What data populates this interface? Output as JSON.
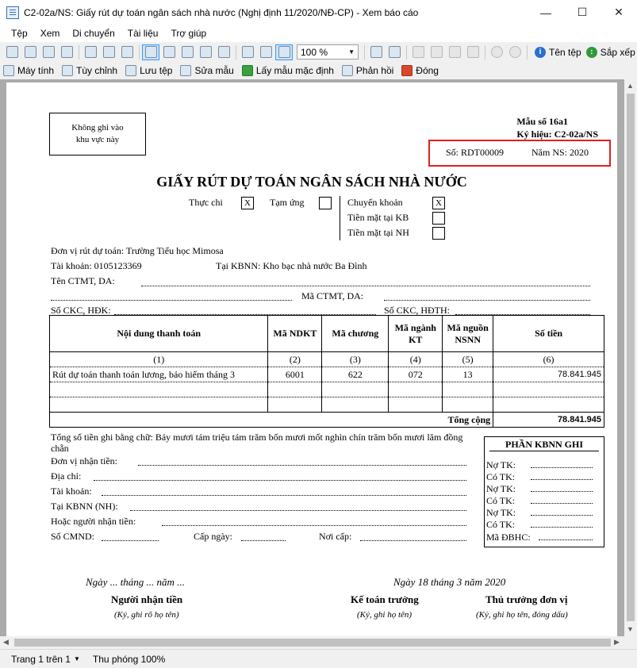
{
  "window": {
    "title": "C2-02a/NS: Giấy rút dự toán ngân sách nhà nước (Nghị định 11/2020/NĐ-CP) - Xem báo cáo",
    "minimize": "—",
    "maximize": "☐",
    "close": "✕"
  },
  "menu": [
    "Tệp",
    "Xem",
    "Di chuyển",
    "Tài liệu",
    "Trợ giúp"
  ],
  "toolbar": {
    "zoom": "100 %",
    "file_name": "Tên tệp",
    "arrange": "Sắp xếp"
  },
  "toolbar2": [
    "Máy tính",
    "Tùy chỉnh",
    "Lưu tệp",
    "Sửa mẫu",
    "Lấy mẫu mặc định",
    "Phản hồi",
    "Đóng"
  ],
  "status": {
    "page": "Trang 1 trên 1",
    "zoom": "Thu phóng 100%"
  },
  "doc": {
    "no_write_1": "Không ghi vào",
    "no_write_2": "khu vực này",
    "form_no": "Mẫu số 16a1",
    "symbol": "Ký hiệu: C2-02a/NS",
    "number": "Số: RDT00009",
    "year": "Năm NS: 2020",
    "title": "GIẤY RÚT DỰ TOÁN NGÂN SÁCH NHÀ NƯỚC",
    "chk_thucchi": "Thực chi",
    "chk_tamung": "Tạm ứng",
    "chk_chuyenkhoan": "Chuyển khoản",
    "chk_tienmatkb": "Tiền mặt tại KB",
    "chk_tienmatnh": "Tiền mặt tại NH",
    "x": "X",
    "unit": "Đơn vị rút dự toán: Trường Tiểu học Mimosa",
    "account": "Tài khoản: 0105123369",
    "kbnn": "Tại KBNN: Kho bạc nhà nước Ba Đình",
    "ctmt": "Tên CTMT, DA:",
    "ma_ctmt": "Mã CTMT, DA:",
    "so_ckc": "Số CKC, HĐK:",
    "so_ckc_hdth": "Số CKC, HĐTH:",
    "table": {
      "headers": [
        "Nội dung thanh toán",
        "Mã NDKT",
        "Mã chương",
        "Mã ngành KT",
        "Mã nguồn NSNN",
        "Số tiền"
      ],
      "nums": [
        "(1)",
        "(2)",
        "(3)",
        "(4)",
        "(5)",
        "(6)"
      ],
      "rows": [
        [
          "Rút dự toán thanh toán lương, bảo hiểm tháng 3",
          "6001",
          "622",
          "072",
          "13",
          "78.841.945"
        ]
      ],
      "total_label": "Tổng cộng",
      "total": "78.841.945"
    },
    "words": "Tổng số tiền ghi bằng chữ: Bảy mươi tám triệu tám trăm bốn mươi mốt nghìn chín trăm bốn mươi lăm đồng chẵn",
    "payee": "Đơn vị nhận tiền:",
    "address": "Địa chỉ:",
    "acc2": "Tài khoản:",
    "kbnn2": "Tại KBNN (NH):",
    "person": "Hoặc người nhận tiền:",
    "cmnd": "Số CMND:",
    "issue_date": "Cấp ngày:",
    "issue_place": "Nơi cấp:",
    "kbnn_box": {
      "title": "PHẦN KBNN GHI",
      "lines": [
        "Nợ TK:",
        "Có TK:",
        "Nợ TK:",
        "Có TK:",
        "Nợ TK:",
        "Có TK:",
        "Mã ĐBHC:"
      ]
    },
    "date_left": "Ngày ... tháng ... năm ...",
    "date_right": "Ngày 18 tháng 3 năm 2020",
    "sig1": "Người nhận tiền",
    "sig1_note": "(Ký, ghi rõ họ tên)",
    "sig2": "Kế toán trưởng",
    "sig2_note": "(Ký, ghi họ tên)",
    "sig3": "Thủ trưởng đơn vị",
    "sig3_note": "(Ký, ghi họ tên, đóng dấu)"
  }
}
